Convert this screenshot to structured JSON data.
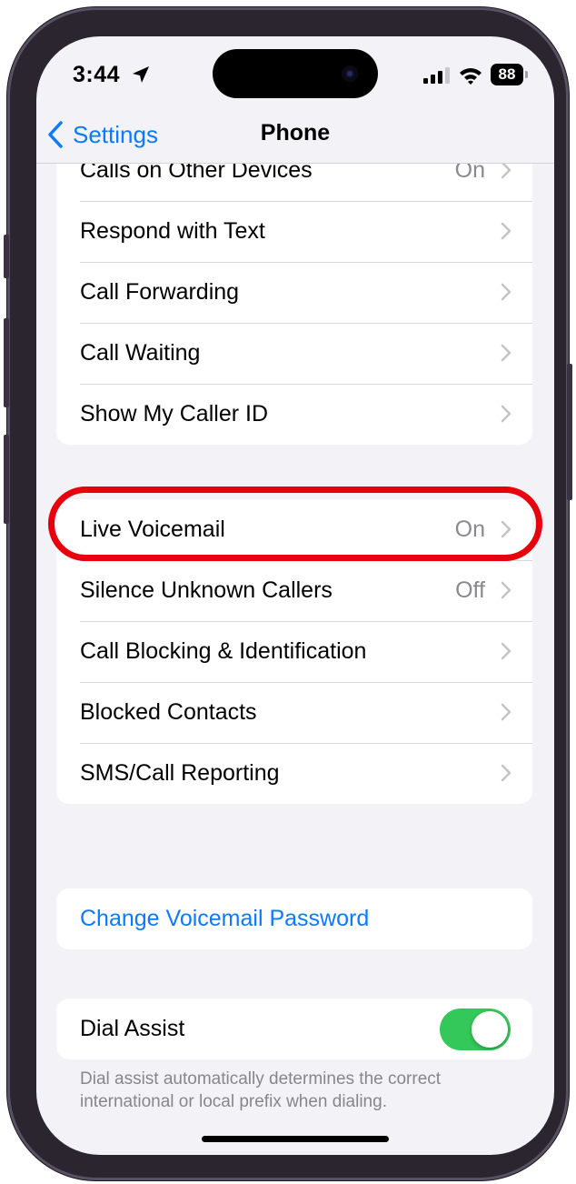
{
  "status_bar": {
    "time": "3:44",
    "battery": "88"
  },
  "nav": {
    "back_label": "Settings",
    "title": "Phone"
  },
  "group1": [
    {
      "label": "Calls on Other Devices",
      "value": "On"
    },
    {
      "label": "Respond with Text",
      "value": ""
    },
    {
      "label": "Call Forwarding",
      "value": ""
    },
    {
      "label": "Call Waiting",
      "value": ""
    },
    {
      "label": "Show My Caller ID",
      "value": ""
    }
  ],
  "group2": [
    {
      "label": "Live Voicemail",
      "value": "On"
    },
    {
      "label": "Silence Unknown Callers",
      "value": "Off"
    },
    {
      "label": "Call Blocking & Identification",
      "value": ""
    },
    {
      "label": "Blocked Contacts",
      "value": ""
    },
    {
      "label": "SMS/Call Reporting",
      "value": ""
    }
  ],
  "voicemail": {
    "change_password": "Change Voicemail Password"
  },
  "dial_assist": {
    "label": "Dial Assist",
    "enabled": true,
    "footnote": "Dial assist automatically determines the correct international or local prefix when dialing."
  },
  "colors": {
    "accent": "#0a7aff",
    "toggle_on": "#34c759",
    "highlight": "#e8000c"
  }
}
